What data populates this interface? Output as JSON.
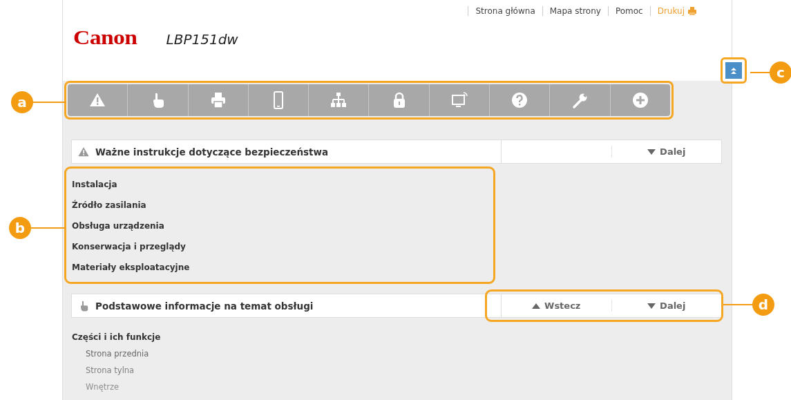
{
  "header_links": [
    {
      "label": "Strona główna",
      "kind": "link"
    },
    {
      "label": "Mapa strony",
      "kind": "link"
    },
    {
      "label": "Pomoc",
      "kind": "link"
    },
    {
      "label": "Drukuj",
      "kind": "print"
    }
  ],
  "brand": {
    "logo": "Canon",
    "model": "LBP151dw"
  },
  "top_button": {
    "callout": "c"
  },
  "toolbar": {
    "callout": "a"
  },
  "sections": [
    {
      "title": "Ważne instrukcje dotyczące bezpieczeństwa",
      "kind": "warning",
      "nav": [
        {
          "label": "Dalej",
          "kind": "next"
        }
      ],
      "items_callout": "b",
      "items": [
        {
          "label": "Instalacja"
        },
        {
          "label": "Źródło zasilania"
        },
        {
          "label": "Obsługa urządzenia"
        },
        {
          "label": "Konserwacja i przeglądy"
        },
        {
          "label": "Materiały eksploatacyjne"
        }
      ]
    },
    {
      "title": "Podstawowe informacje na temat obsługi",
      "kind": "hand",
      "nav": [
        {
          "label": "Wstecz",
          "kind": "previous"
        },
        {
          "label": "Dalej",
          "kind": "next"
        }
      ],
      "nav_callout": "d",
      "items": [
        {
          "label": "Części i ich funkcje",
          "children": [
            {
              "label": "Strona przednia"
            },
            {
              "label": "Strona tylna"
            },
            {
              "label": "Wnętrze"
            }
          ]
        }
      ]
    }
  ]
}
